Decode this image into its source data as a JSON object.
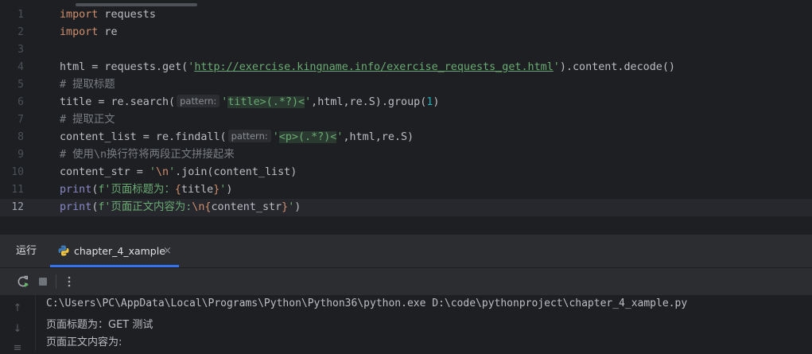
{
  "editor": {
    "line_numbers": [
      "1",
      "2",
      "3",
      "4",
      "5",
      "6",
      "7",
      "8",
      "9",
      "10",
      "11",
      "12"
    ],
    "current_line": "12",
    "lines": {
      "l1_kw": "import",
      "l1_rest": " requests",
      "l2_kw": "import",
      "l2_rest": " re",
      "l4_pre": "html = requests.get(",
      "l4_q1": "'",
      "l4_url": "http://exercise.kingname.info/exercise_requests_get.html",
      "l4_q2": "'",
      "l4_post": ").content.decode()",
      "l5": "# 提取标题",
      "l6_pre": "title = re.search(",
      "l6_hint": "pattern:",
      "l6_q1": "'",
      "l6_regex": "title>(.*?)<",
      "l6_q2": "'",
      "l6_mid": ",html,re.S).group(",
      "l6_num": "1",
      "l6_post": ")",
      "l7": "# 提取正文",
      "l8_pre": "content_list = re.findall(",
      "l8_hint": "pattern:",
      "l8_q1": "'",
      "l8_regex": "<p>(.*?)<",
      "l8_q2": "'",
      "l8_post": ",html,re.S)",
      "l9": "# 使用\\n换行符将两段正文拼接起来",
      "l10_pre": "content_str = ",
      "l10_str1": "'",
      "l10_esc": "\\n",
      "l10_str2": "'",
      "l10_post": ".join(content_list)",
      "l11_fn": "print",
      "l11_p1": "(",
      "l11_s1": "f'页面标题为：",
      "l11_b1": "{",
      "l11_var": "title",
      "l11_b2": "}",
      "l11_s2": "'",
      "l11_p2": ")",
      "l12_fn": "print",
      "l12_p1": "(",
      "l12_s1": "f'页面正文内容为:",
      "l12_esc": "\\n",
      "l12_b1": "{",
      "l12_var": "content_str",
      "l12_b2": "}",
      "l12_s2": "'",
      "l12_p2": ")"
    }
  },
  "run_panel": {
    "run_tab_label": "运行",
    "config_tab_label": "chapter_4_xample",
    "close_glyph": "×"
  },
  "console": {
    "lines": [
      "C:\\Users\\PC\\AppData\\Local\\Programs\\Python\\Python36\\python.exe D:\\code\\pythonproject\\chapter_4_xample.py",
      "页面标题为：GET 测试",
      "页面正文内容为:"
    ],
    "up_glyph": "↑",
    "down_glyph": "↓",
    "menu_glyph": "≡"
  },
  "colors": {
    "keyword": "#cf8e6d",
    "string": "#6aab73",
    "number": "#2aacb8",
    "comment": "#7a7e85",
    "tab_underline": "#3574f0",
    "rerun_icon": "#5fb865"
  }
}
